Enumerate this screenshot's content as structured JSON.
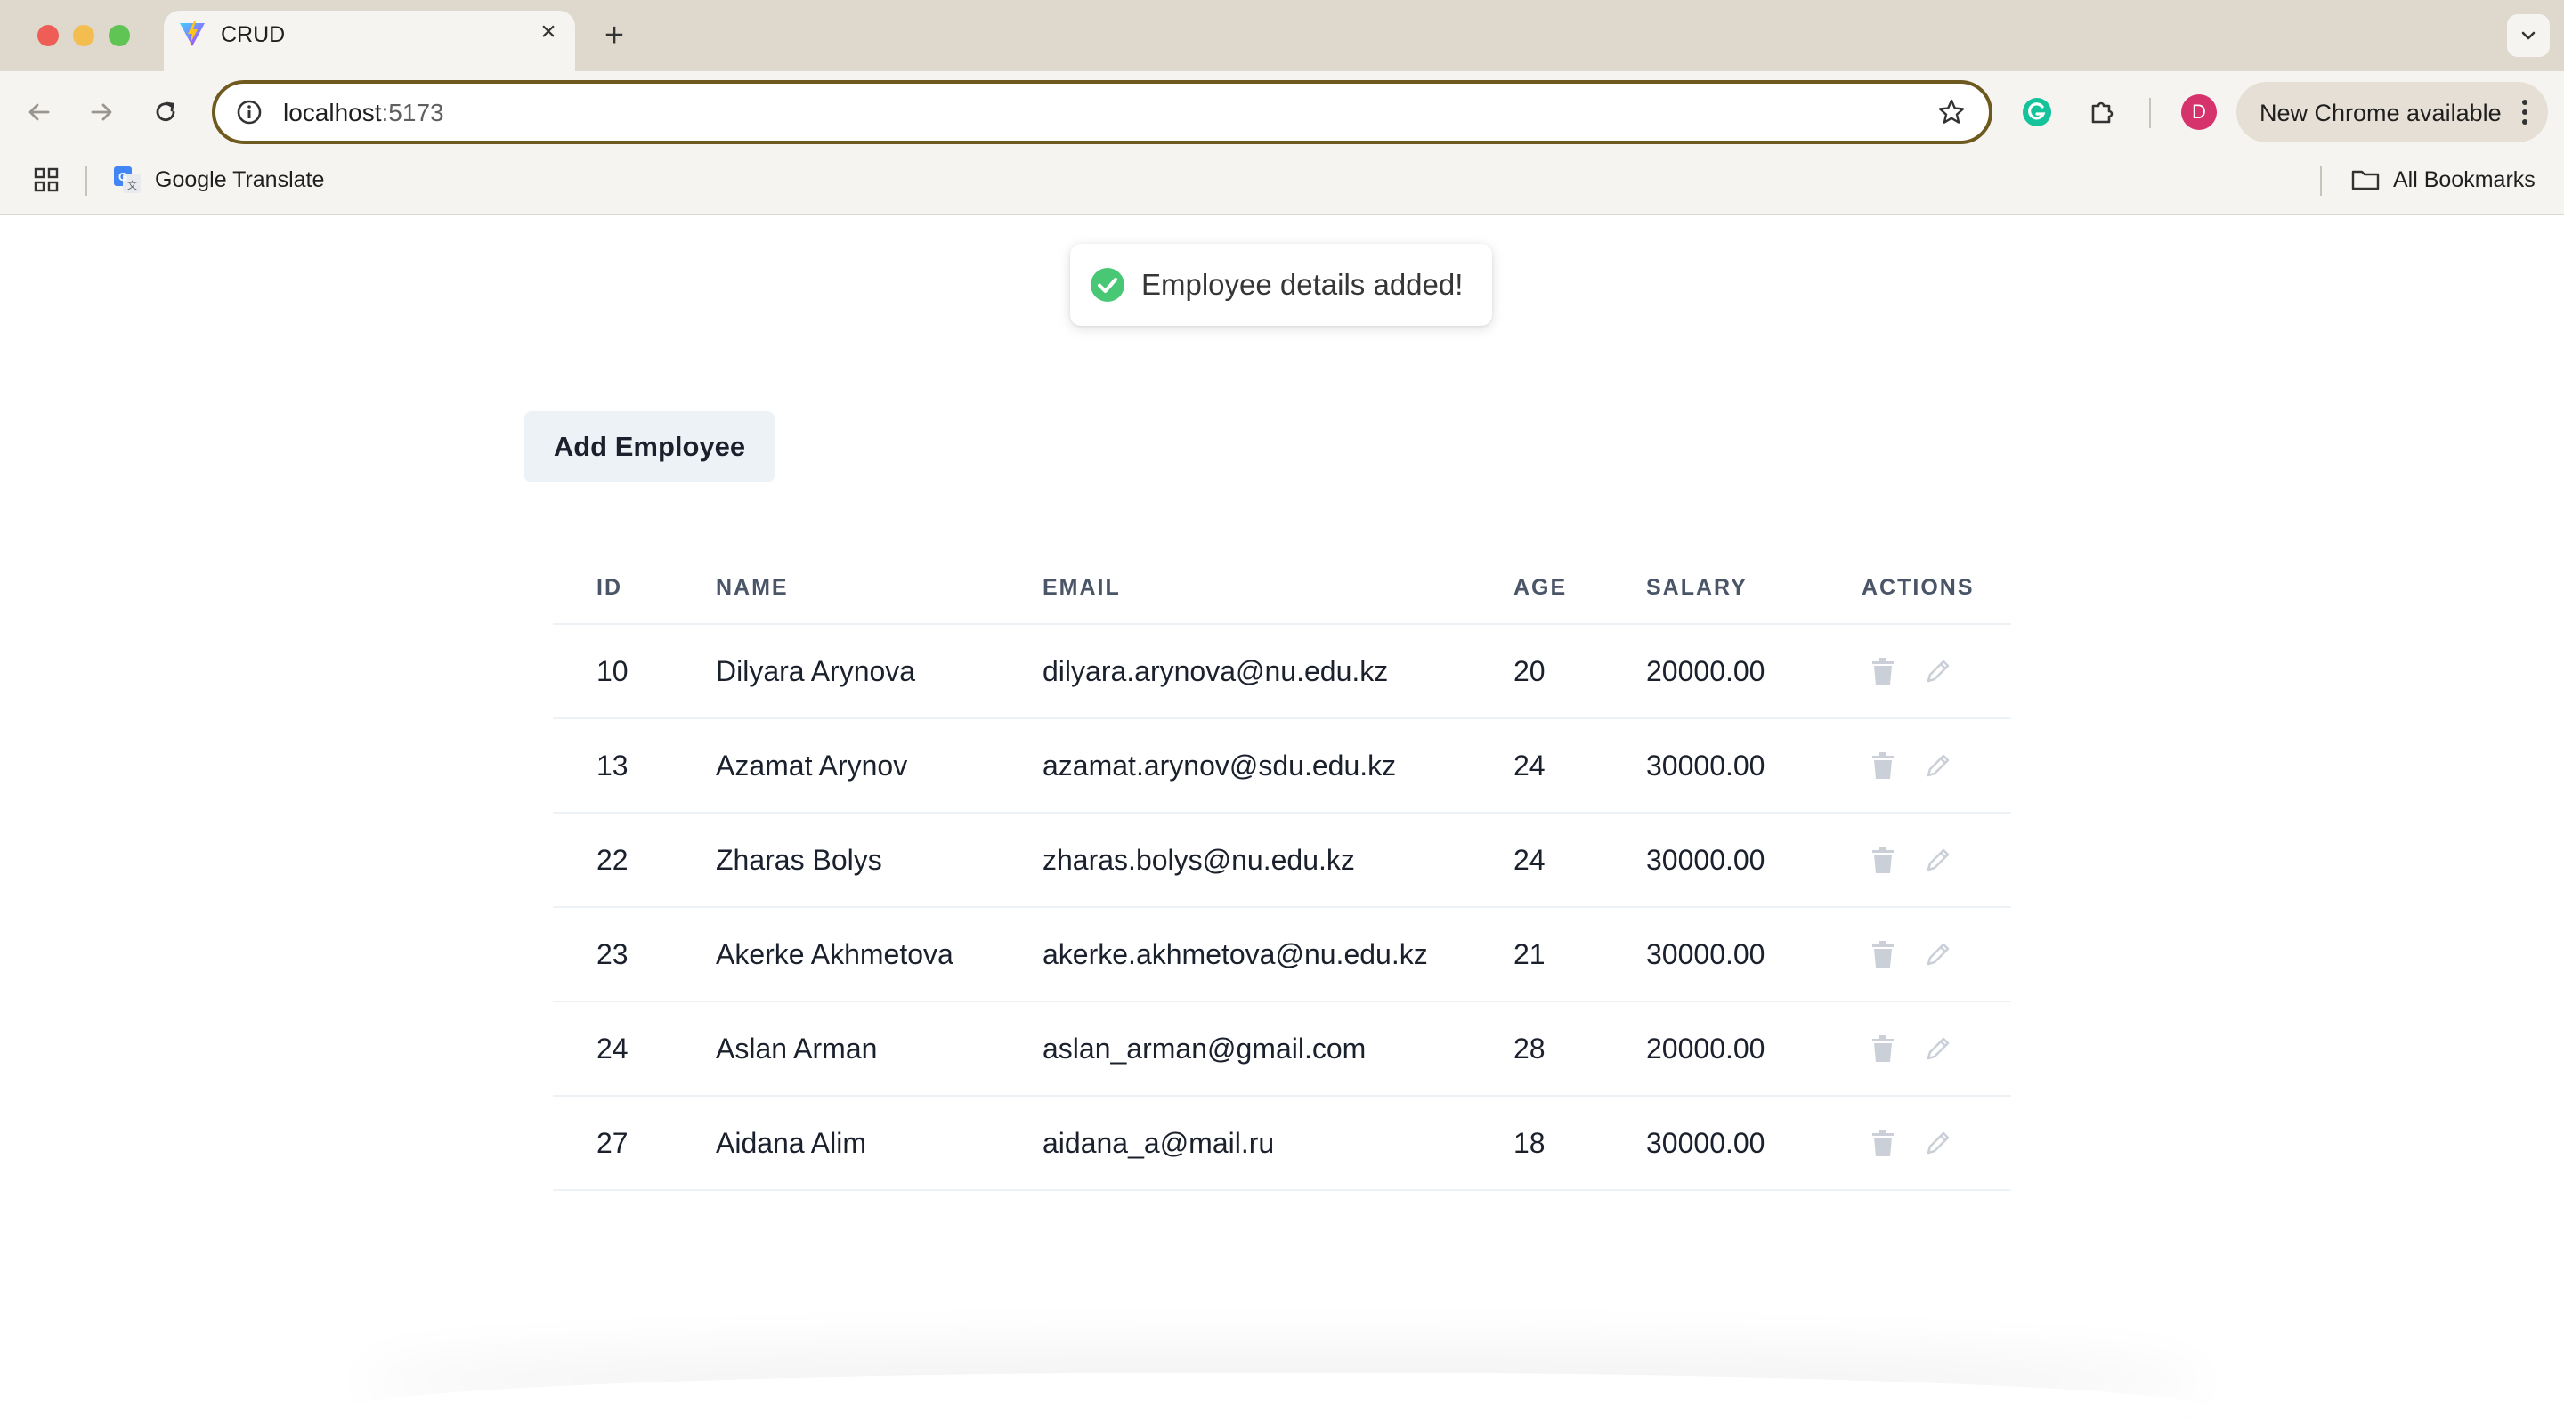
{
  "browser": {
    "tab_title": "CRUD",
    "url_host": "localhost",
    "url_port": ":5173",
    "avatar_initial": "D",
    "update_label": "New Chrome available",
    "bookmarks": [
      {
        "label": "Google Translate",
        "icon": "google-translate-icon"
      }
    ],
    "all_bookmarks_label": "All Bookmarks"
  },
  "toast": {
    "message": "Employee details added!",
    "icon": "check-circle-icon",
    "color": "#48c774"
  },
  "page": {
    "add_button_label": "Add Employee"
  },
  "table": {
    "columns": [
      "ID",
      "NAME",
      "EMAIL",
      "AGE",
      "SALARY",
      "ACTIONS"
    ],
    "rows": [
      {
        "id": "10",
        "name": "Dilyara Arynova",
        "email": "dilyara.arynova@nu.edu.kz",
        "age": "20",
        "salary": "20000.00"
      },
      {
        "id": "13",
        "name": "Azamat Arynov",
        "email": "azamat.arynov@sdu.edu.kz",
        "age": "24",
        "salary": "30000.00"
      },
      {
        "id": "22",
        "name": "Zharas Bolys",
        "email": "zharas.bolys@nu.edu.kz",
        "age": "24",
        "salary": "30000.00"
      },
      {
        "id": "23",
        "name": "Akerke Akhmetova",
        "email": "akerke.akhmetova@nu.edu.kz",
        "age": "21",
        "salary": "30000.00"
      },
      {
        "id": "24",
        "name": "Aslan Arman",
        "email": "aslan_arman@gmail.com",
        "age": "28",
        "salary": "20000.00"
      },
      {
        "id": "27",
        "name": "Aidana Alim",
        "email": "aidana_a@mail.ru",
        "age": "18",
        "salary": "30000.00"
      }
    ],
    "row_actions": [
      "trash-icon",
      "pencil-icon"
    ]
  },
  "colors": {
    "accent_omnibox": "#6e5a1e",
    "button_bg": "#edf2f7",
    "action_icon": "#cbd0d8"
  }
}
